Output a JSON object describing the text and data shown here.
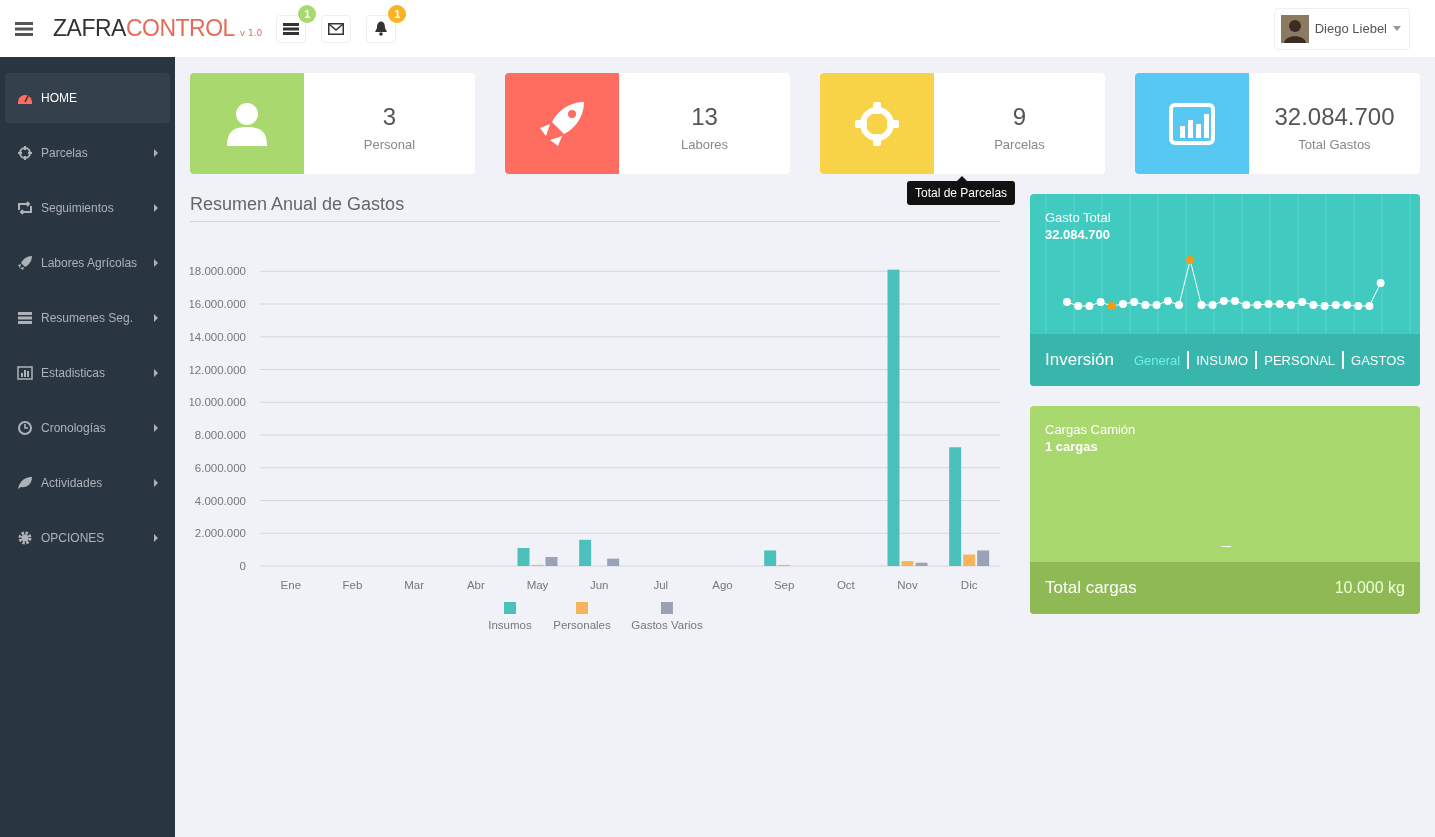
{
  "header": {
    "brand_first": "ZAFRA",
    "brand_second": "CONTROL",
    "version": "v 1.0",
    "buttons": [
      {
        "kind": "tasks",
        "badge": "1"
      },
      {
        "kind": "mail"
      },
      {
        "kind": "notifications",
        "badge": "1"
      }
    ],
    "user": "Diego Liebel"
  },
  "sidebar": {
    "items": [
      {
        "label": "HOME",
        "selected": true,
        "submenu": false
      },
      {
        "label": "Parcelas",
        "selected": false,
        "submenu": true
      },
      {
        "label": "Seguimientos",
        "selected": false,
        "submenu": true
      },
      {
        "label": "Labores Agrícolas",
        "selected": false,
        "submenu": true
      },
      {
        "label": "Resumenes Seg.",
        "selected": false,
        "submenu": true
      },
      {
        "label": "Estadisticas",
        "selected": false,
        "submenu": true
      },
      {
        "label": "Cronologías",
        "selected": false,
        "submenu": true
      },
      {
        "label": "Actividades",
        "selected": false,
        "submenu": true
      },
      {
        "label": "OPCIONES",
        "selected": false,
        "submenu": true
      }
    ]
  },
  "stats": [
    {
      "value": "3",
      "label": "Personal",
      "color": "#a9d86e"
    },
    {
      "value": "13",
      "label": "Labores",
      "color": "#ff6c60"
    },
    {
      "value": "9",
      "label": "Parcelas",
      "color": "#f8d347"
    },
    {
      "value": "32.084.700",
      "label": "Total Gastos",
      "color": "#57c8f2"
    }
  ],
  "tooltip": "Total de Parcelas",
  "chart_section": {
    "title": "Resumen Anual de Gastos",
    "chart_data": {
      "type": "bar",
      "categories": [
        "Ene",
        "Feb",
        "Mar",
        "Abr",
        "May",
        "Jun",
        "Jul",
        "Ago",
        "Sep",
        "Oct",
        "Nov",
        "Dic"
      ],
      "series": [
        {
          "name": "Insumos",
          "color": "#4cc0bb",
          "values": [
            0,
            0,
            0,
            0,
            1100000,
            1600000,
            0,
            0,
            950000,
            0,
            18100000,
            7250000
          ]
        },
        {
          "name": "Personales",
          "color": "#f8b35c",
          "values": [
            0,
            0,
            0,
            0,
            70000,
            0,
            0,
            0,
            70000,
            0,
            300000,
            700000
          ]
        },
        {
          "name": "Gastos Varios",
          "color": "#99a3b5",
          "values": [
            0,
            0,
            0,
            0,
            550000,
            450000,
            0,
            0,
            0,
            0,
            200000,
            950000
          ]
        }
      ],
      "ylim": [
        0,
        18200000
      ],
      "grid": true,
      "legend": "bottom",
      "yticks": [
        {
          "value": 0,
          "label": "0"
        },
        {
          "value": 2000000,
          "label": "2.000.000"
        },
        {
          "value": 4000000,
          "label": "4.000.000"
        },
        {
          "value": 6000000,
          "label": "6.000.000"
        },
        {
          "value": 8000000,
          "label": "8.000.000"
        },
        {
          "value": 10000000,
          "label": "10.000.000"
        },
        {
          "value": 12000000,
          "label": "12.000.000"
        },
        {
          "value": 14000000,
          "label": "14.000.000"
        },
        {
          "value": 16000000,
          "label": "16.000.000"
        },
        {
          "value": 18000000,
          "label": "18.000.000"
        }
      ]
    }
  },
  "gasto_card": {
    "title": "Gasto Total",
    "value": "32.084.700",
    "footer_title": "Inversión",
    "tabs": [
      {
        "label": "General",
        "selected": true
      },
      {
        "label": "INSUMO",
        "selected": false
      },
      {
        "label": "PERSONAL",
        "selected": false
      },
      {
        "label": "GASTOS",
        "selected": false
      }
    ]
  },
  "cargas_card": {
    "title": "Cargas Camión",
    "value": "1 cargas",
    "footer_title": "Total cargas",
    "footer_value": "10.000 kg"
  }
}
